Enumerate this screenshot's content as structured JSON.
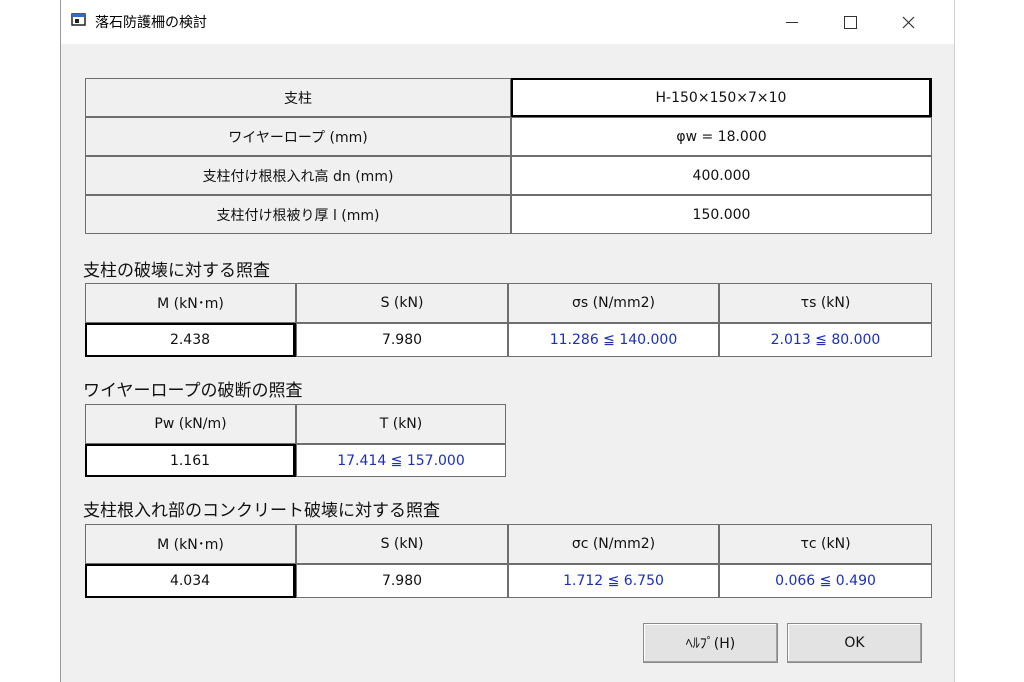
{
  "window": {
    "title": "落石防護柵の検討",
    "controls": {
      "minimize": "minimize-icon",
      "maximize": "maximize-icon",
      "close": "close-icon"
    }
  },
  "spec_table": {
    "rows": [
      {
        "label": "支柱",
        "value": "H-150×150×7×10"
      },
      {
        "label": "ワイヤーロープ (mm)",
        "value": "φw = 18.000"
      },
      {
        "label": "支柱付け根根入れ高 dn (mm)",
        "value": "400.000"
      },
      {
        "label": "支柱付け根被り厚 l (mm)",
        "value": "150.000"
      }
    ]
  },
  "post_check": {
    "title": "支柱の破壊に対する照査",
    "headers": [
      "M (kN･m)",
      "S (kN)",
      "σs (N/mm2)",
      "τs (kN)"
    ],
    "values": [
      "2.438",
      "7.980",
      "11.286 ≦ 140.000",
      "2.013 ≦ 80.000"
    ]
  },
  "wire_check": {
    "title": "ワイヤーロープの破断の照査",
    "headers": [
      "Pw (kN/m)",
      "T (kN)"
    ],
    "values": [
      "1.161",
      "17.414 ≦ 157.000"
    ]
  },
  "concrete_check": {
    "title": "支柱根入れ部のコンクリート破壊に対する照査",
    "headers": [
      "M (kN･m)",
      "S (kN)",
      "σc (N/mm2)",
      "τc (kN)"
    ],
    "values": [
      "4.034",
      "7.980",
      "1.712 ≦ 6.750",
      "0.066 ≦ 0.490"
    ]
  },
  "buttons": {
    "help": "ﾍﾙﾌﾟ(H)",
    "ok": "OK"
  },
  "colors": {
    "check_value": "#1a2fbe"
  }
}
